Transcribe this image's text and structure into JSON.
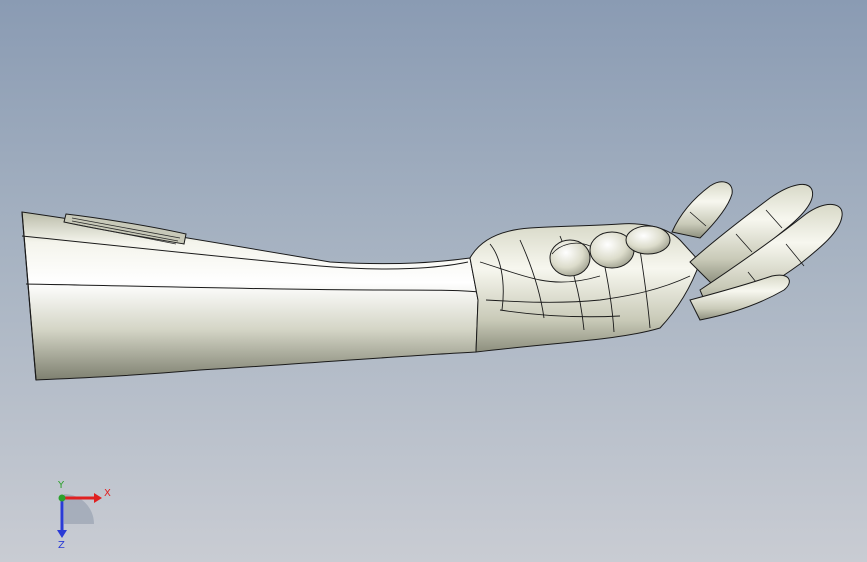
{
  "viewport": {
    "background_top": "#8a9bb3",
    "background_bottom": "#c9ccd3",
    "model_name": "forearm-hand-model"
  },
  "model": {
    "surface_color": "#e6e7dc",
    "edge_color": "#1a1a1a"
  },
  "triad": {
    "x_label": "X",
    "y_label": "Y",
    "z_label": "Z",
    "x_color": "#e02020",
    "y_color": "#2ca02c",
    "z_color": "#2a3bd6"
  }
}
